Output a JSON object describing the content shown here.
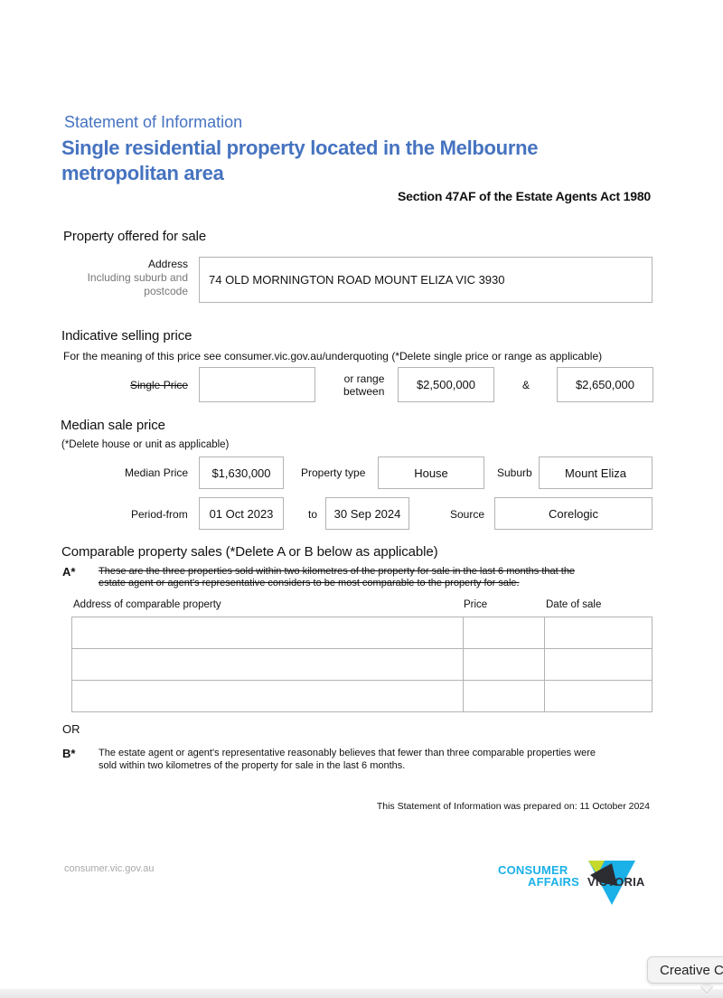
{
  "header": {
    "subtitle": "Statement of Information",
    "title_line1": "Single residential property located in the Melbourne",
    "title_line2": "metropolitan area",
    "act_reference": "Section 47AF of the Estate Agents Act 1980"
  },
  "property": {
    "section_title": "Property offered for sale",
    "address_label": "Address",
    "address_sublabel_1": "Including suburb and",
    "address_sublabel_2": "postcode",
    "address_value": "74 OLD MORNINGTON ROAD MOUNT ELIZA VIC 3930"
  },
  "indicative_price": {
    "section_title": "Indicative selling price",
    "note": "For the meaning of this price see consumer.vic.gov.au/underquoting (*Delete single price or range as applicable)",
    "single_price_label": "Single Price",
    "single_price_value": "",
    "range_label_1": "or range",
    "range_label_2": "between",
    "range_low": "$2,500,000",
    "range_sep": "&",
    "range_high": "$2,650,000"
  },
  "median": {
    "section_title": "Median sale price",
    "note": "(*Delete house or unit as applicable)",
    "median_price_label": "Median Price",
    "median_price_value": "$1,630,000",
    "property_type_label": "Property type",
    "property_type_value": "House",
    "suburb_label": "Suburb",
    "suburb_value": "Mount Eliza",
    "period_from_label": "Period-from",
    "period_from_value": "01 Oct 2023",
    "period_to_label": "to",
    "period_to_value": "30 Sep 2024",
    "source_label": "Source",
    "source_value": "Corelogic"
  },
  "comparable": {
    "section_title": "Comparable property sales (*Delete A or B below as applicable)",
    "option_a_marker": "A*",
    "option_a_line1": "These are the three properties sold within two kilometres of the property for sale in the last 6 months that the",
    "option_a_line2": "estate agent or agent's representative considers to be most comparable to the property for sale.",
    "columns": [
      "Address of comparable property",
      "Price",
      "Date of sale"
    ],
    "rows": [
      [
        "",
        "",
        ""
      ],
      [
        "",
        "",
        ""
      ],
      [
        "",
        "",
        ""
      ]
    ],
    "or_label": "OR",
    "option_b_marker": "B*",
    "option_b_line1": "The estate agent or agent's representative reasonably believes that fewer than three comparable properties were",
    "option_b_line2": "sold within two kilometres of the property for sale in the last 6 months."
  },
  "prepared": "This Statement of Information was prepared on: 11 October 2024",
  "footer": {
    "website": "consumer.vic.gov.au",
    "logo_line1": "CONSUMER",
    "logo_line2": "AFFAIRS",
    "logo_line3": "VICTORIA"
  },
  "tooltip": {
    "text": "Creative C"
  },
  "colors": {
    "heading_blue": "#4673c0",
    "logo_cyan": "#1ab0e8",
    "logo_lime": "#c5d92d",
    "logo_dark": "#2b2d33"
  }
}
